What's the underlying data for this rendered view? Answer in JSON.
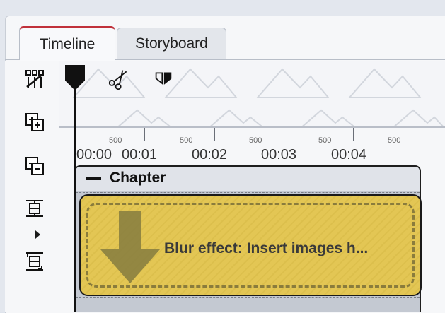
{
  "tabs": [
    {
      "label": "Timeline",
      "active": true
    },
    {
      "label": "Storyboard",
      "active": false
    }
  ],
  "toolbar": {
    "icons": [
      "split-tracks-icon",
      "add-track-icon",
      "remove-track-icon",
      "fit-icon",
      "expand-icon"
    ]
  },
  "ruler": {
    "small_labels": [
      "500",
      "500",
      "500",
      "500",
      "500"
    ],
    "time_labels": [
      "00:00",
      "00:01",
      "00:02",
      "00:03",
      "00:04"
    ]
  },
  "chapter": {
    "title": "Chapter"
  },
  "effect": {
    "label": "Blur effect: Insert images h..."
  },
  "colors": {
    "tab_accent": "#c0303a",
    "effect_fill": "#e3c654",
    "chapter_bg": "#c4c9d2"
  }
}
